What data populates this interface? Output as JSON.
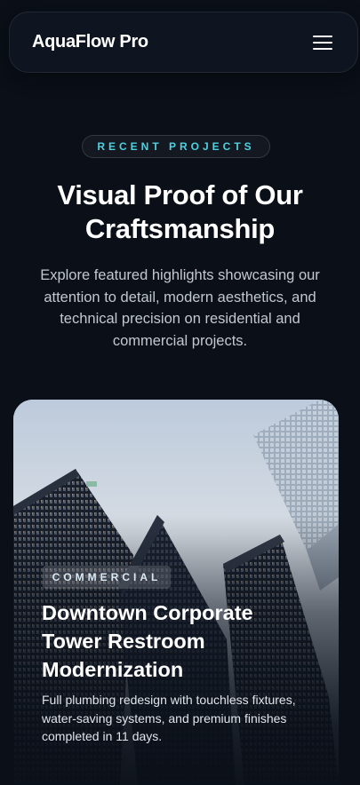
{
  "header": {
    "brand": "AquaFlow Pro",
    "menu_icon": "hamburger-menu-icon"
  },
  "section": {
    "eyebrow": "RECENT PROJECTS",
    "title_line1": "Visual Proof of Our",
    "title_line2": "Craftsmanship",
    "description": "Explore featured highlights showcasing our attention to detail, modern aesthetics, and technical precision on residential and commercial projects."
  },
  "project": {
    "category": "COMMERCIAL",
    "title_line1": "Downtown Corporate",
    "title_line2": "Tower Restroom",
    "title_line3": "Modernization",
    "description": "Full plumbing redesign with touchless fixtures, water-saving systems, and premium finishes completed in 11 days.",
    "image_icon": "skyscrapers-photo"
  },
  "colors": {
    "background": "#0a0f18",
    "accent": "#4fd1e0",
    "text": "#ffffff",
    "muted_text": "#c2c8d2"
  }
}
